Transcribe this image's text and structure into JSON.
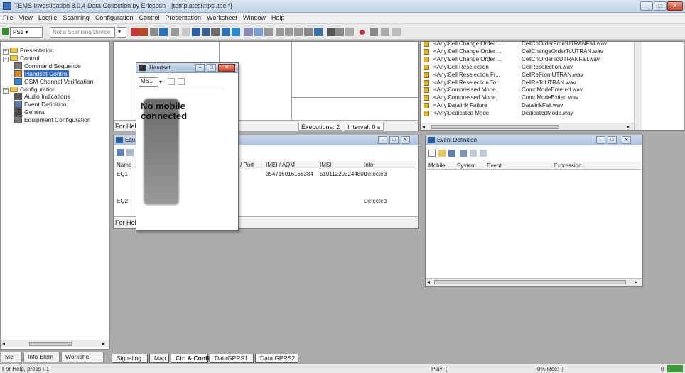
{
  "window": {
    "title": "TEMS Investigation 8.0.4 Data Collection by Ericsson - [templateskripsi.tdc *]",
    "minimize": "–",
    "maximize": "□",
    "close": "✕"
  },
  "menu": [
    "File",
    "View",
    "Logfile",
    "Scanning",
    "Configuration",
    "Control",
    "Presentation",
    "Worksheet",
    "Window",
    "Help"
  ],
  "toolbar": {
    "device_combo": "PS1",
    "scanning_combo": "Not a Scanning Device"
  },
  "navigator": {
    "items": [
      {
        "label": "Presentation",
        "level": 0,
        "expander": "+"
      },
      {
        "label": "Control",
        "level": 0,
        "expander": "−"
      },
      {
        "label": "Command Sequence",
        "level": 1
      },
      {
        "label": "Handset Control",
        "level": 1,
        "selected": true
      },
      {
        "label": "GSM Channel Verification",
        "level": 1
      },
      {
        "label": "Configuration",
        "level": 0,
        "expander": "−"
      },
      {
        "label": "Audio Indications",
        "level": 1
      },
      {
        "label": "Event Definition",
        "level": 1
      },
      {
        "label": "General",
        "level": 1
      },
      {
        "label": "Equipment Configuration",
        "level": 1
      }
    ],
    "tabs": [
      "Me",
      "Info Elem",
      "Workshe"
    ]
  },
  "command_window": {
    "footer_left": "For Hel",
    "executions": "Executions: 2",
    "interval": "Interval: 0 s"
  },
  "equipment_window": {
    "title": "Equ",
    "footer": "For Hel",
    "columns": [
      "Name",
      "/ Port",
      "IMEI / AQM",
      "IMSI",
      "Info"
    ],
    "rows": [
      {
        "name": "EQ1",
        "imei": "354716016166384",
        "imsi": "510112203244800",
        "info": "Detected"
      },
      {
        "name": "EQ2",
        "imei": "",
        "imsi": "",
        "info": "Detected"
      }
    ]
  },
  "handset_window": {
    "title": "Handset ...",
    "device": "MS1",
    "message": "No mobile connected"
  },
  "audio_list": {
    "rows": [
      {
        "any": "<Any>",
        "event": "Cell Change Order ...",
        "file": "CellChOrderFromUTRANFail.wav"
      },
      {
        "any": "<Any>",
        "event": "Cell Change Order ...",
        "file": "CellChangeOrderToUTRAN.wav"
      },
      {
        "any": "<Any>",
        "event": "Cell Change Order ...",
        "file": "CellChOrderToUTRANFail.wav"
      },
      {
        "any": "<Any>",
        "event": "Cell Reselection",
        "file": "CellReselection.wav"
      },
      {
        "any": "<Any>",
        "event": "Cell Reselection Fr...",
        "file": "CellReFromUTRAN.wav"
      },
      {
        "any": "<Any>",
        "event": "Cell Reselection To...",
        "file": "CellReToUTRAN.wav"
      },
      {
        "any": "<Any>",
        "event": "Compressed Mode...",
        "file": "CompModeEntered.wav"
      },
      {
        "any": "<Any>",
        "event": "Compressed Mode...",
        "file": "CompModeExited.wav"
      },
      {
        "any": "<Any>",
        "event": "Datalink Failure",
        "file": "DatalinkFail.wav"
      },
      {
        "any": "<Any>",
        "event": "Dedicated Mode",
        "file": "DedicatedMode.wav"
      }
    ]
  },
  "event_definition": {
    "title": "Event Definition",
    "columns": [
      "Mobile",
      "System",
      "Event",
      "Expression"
    ]
  },
  "worksheet_tabs": [
    "Signaling",
    "Map",
    "Ctrl & Config",
    "DataGPRS1",
    "Data GPRS2"
  ],
  "active_tab": "Ctrl & Config",
  "status": {
    "help": "For Help, press F1",
    "play": "Play: []",
    "rec": "0% Rec: []",
    "right": "0"
  },
  "colors": {
    "titlebar": "#c2d3e8",
    "selection": "#316ac5",
    "close": "#c8452a"
  }
}
